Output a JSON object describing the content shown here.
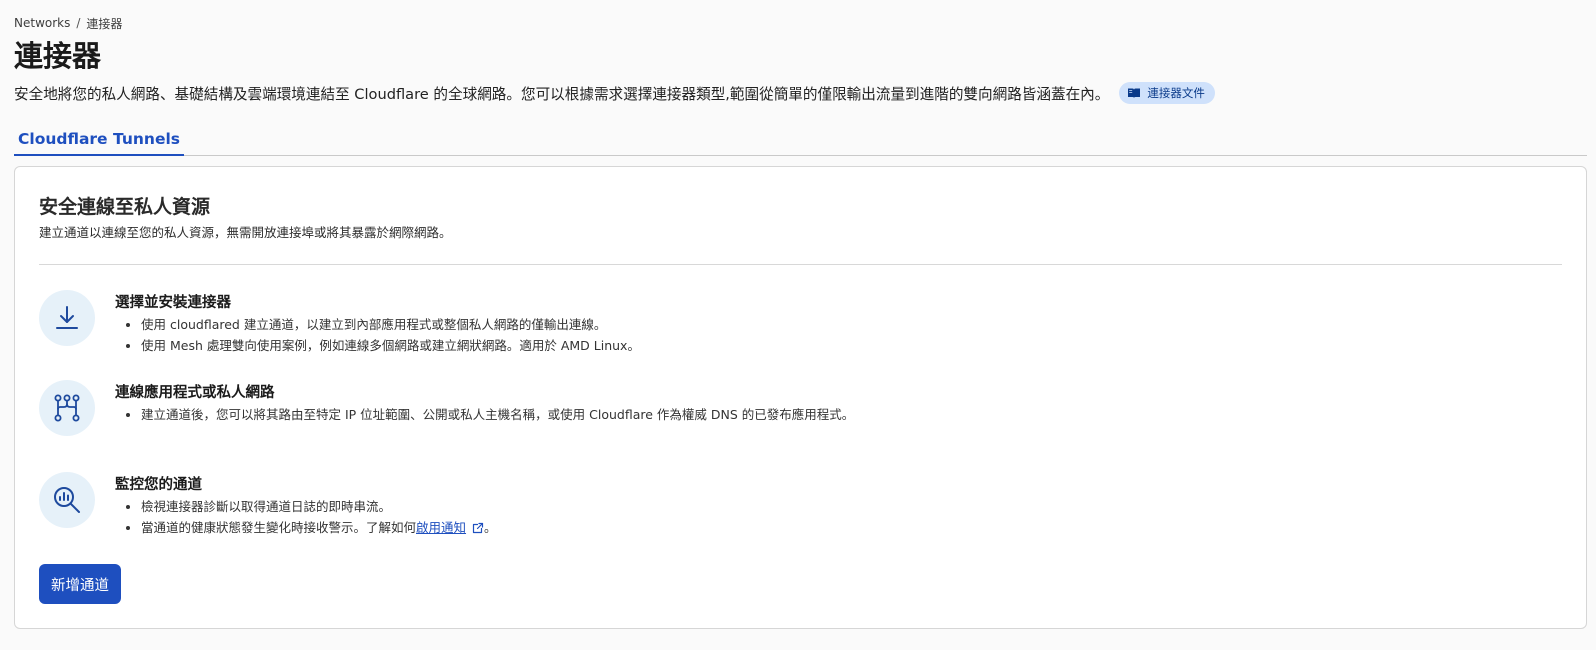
{
  "breadcrumb": {
    "parent": "Networks",
    "separator": "/",
    "current": "連接器"
  },
  "page_title": "連接器",
  "description": "安全地將您的私人網路、基礎結構及雲端環境連結至 Cloudflare 的全球網路。您可以根據需求選擇連接器類型,範圍從簡單的僅限輸出流量到進階的雙向網路皆涵蓋在內。",
  "docs_link": {
    "icon": "book-icon",
    "label": "連接器文件"
  },
  "tabs": [
    {
      "label": "Cloudflare Tunnels",
      "active": true
    }
  ],
  "card": {
    "title": "安全連線至私人資源",
    "subtitle": "建立通道以連線至您的私人資源，無需開放連接埠或將其暴露於網際網路。",
    "features": [
      {
        "icon": "download-icon",
        "title": "選擇並安裝連接器",
        "bullets": [
          "使用 cloudflared 建立通道，以建立到內部應用程式或整個私人網路的僅輸出連線。",
          "使用 Mesh 處理雙向使用案例，例如連線多個網路或建立網狀網路。適用於 AMD Linux。"
        ]
      },
      {
        "icon": "git-branch-icon",
        "title": "連線應用程式或私人網路",
        "bullets": [
          "建立通道後，您可以將其路由至特定 IP 位址範圍、公開或私人主機名稱，或使用 Cloudflare 作為權威 DNS 的已發布應用程式。"
        ]
      },
      {
        "icon": "search-chart-icon",
        "title": "監控您的通道",
        "bullets": [
          "檢視連接器診斷以取得通道日誌的即時串流。"
        ],
        "last_bullet": {
          "prefix": "當通道的健康狀態發生變化時接收警示。了解如何",
          "link": "啟用通知",
          "suffix": "。"
        }
      }
    ],
    "button_label": "新增通道"
  },
  "colors": {
    "accent": "#1e4fbf",
    "icon_bg": "#e6f1f9",
    "pill_bg": "#cfe1fb",
    "icon_stroke": "#1e4a9e"
  }
}
